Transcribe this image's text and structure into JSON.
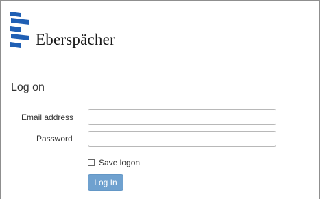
{
  "header": {
    "brand_name": "Eberspächer",
    "logo_icon": "eberspaecher-logo-icon"
  },
  "login": {
    "title": "Log on",
    "email_label": "Email address",
    "email_value": "",
    "password_label": "Password",
    "password_value": "",
    "save_logon_label": "Save logon",
    "save_logon_checked": false,
    "submit_label": "Log In"
  },
  "colors": {
    "brand_blue": "#1f5fb4",
    "button_blue": "#6fa1cf",
    "text": "#333333"
  }
}
